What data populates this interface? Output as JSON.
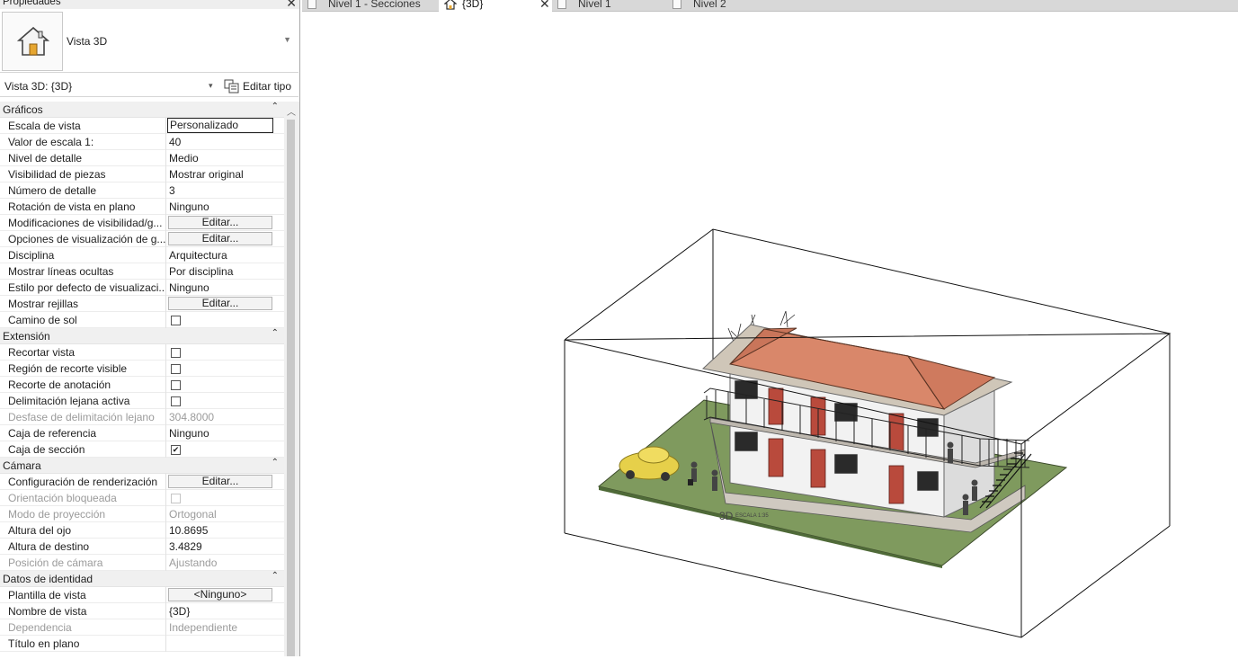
{
  "properties": {
    "title": "Propiedades",
    "type_name": "Vista 3D",
    "selector": "Vista 3D: {3D}",
    "edit_type": "Editar tipo",
    "sections": [
      {
        "name": "Gráficos",
        "rows": [
          {
            "label": "Escala de vista",
            "value": "Personalizado",
            "kind": "input"
          },
          {
            "label": "Valor de escala    1:",
            "value": "40",
            "kind": "text"
          },
          {
            "label": "Nivel de detalle",
            "value": "Medio",
            "kind": "text"
          },
          {
            "label": "Visibilidad de piezas",
            "value": "Mostrar original",
            "kind": "text"
          },
          {
            "label": "Número de detalle",
            "value": "3",
            "kind": "text"
          },
          {
            "label": "Rotación de vista en plano",
            "value": "Ninguno",
            "kind": "text"
          },
          {
            "label": "Modificaciones de visibilidad/g...",
            "value": "Editar...",
            "kind": "button"
          },
          {
            "label": "Opciones de visualización de g...",
            "value": "Editar...",
            "kind": "button"
          },
          {
            "label": "Disciplina",
            "value": "Arquitectura",
            "kind": "text"
          },
          {
            "label": "Mostrar líneas ocultas",
            "value": "Por disciplina",
            "kind": "text"
          },
          {
            "label": "Estilo por defecto de visualizaci...",
            "value": "Ninguno",
            "kind": "text"
          },
          {
            "label": "Mostrar rejillas",
            "value": "Editar...",
            "kind": "button"
          },
          {
            "label": "Camino de sol",
            "value": "",
            "kind": "check",
            "checked": false
          }
        ]
      },
      {
        "name": "Extensión",
        "rows": [
          {
            "label": "Recortar vista",
            "value": "",
            "kind": "check",
            "checked": false
          },
          {
            "label": "Región de recorte visible",
            "value": "",
            "kind": "check",
            "checked": false
          },
          {
            "label": "Recorte de anotación",
            "value": "",
            "kind": "check",
            "checked": false
          },
          {
            "label": "Delimitación lejana activa",
            "value": "",
            "kind": "check",
            "checked": false
          },
          {
            "label": "Desfase de delimitación lejano",
            "value": "304.8000",
            "kind": "text",
            "disabled": true
          },
          {
            "label": "Caja de referencia",
            "value": "Ninguno",
            "kind": "text"
          },
          {
            "label": "Caja de sección",
            "value": "",
            "kind": "check",
            "checked": true
          }
        ]
      },
      {
        "name": "Cámara",
        "rows": [
          {
            "label": "Configuración de renderización",
            "value": "Editar...",
            "kind": "button"
          },
          {
            "label": "Orientación bloqueada",
            "value": "",
            "kind": "check",
            "checked": false,
            "disabled": true
          },
          {
            "label": "Modo de proyección",
            "value": "Ortogonal",
            "kind": "text",
            "disabled": true
          },
          {
            "label": "Altura del ojo",
            "value": "10.8695",
            "kind": "text"
          },
          {
            "label": "Altura de destino",
            "value": "3.4829",
            "kind": "text"
          },
          {
            "label": "Posición de cámara",
            "value": "Ajustando",
            "kind": "text",
            "disabled": true
          }
        ]
      },
      {
        "name": "Datos de identidad",
        "rows": [
          {
            "label": "Plantilla de vista",
            "value": "<Ninguno>",
            "kind": "button"
          },
          {
            "label": "Nombre de vista",
            "value": "{3D}",
            "kind": "text"
          },
          {
            "label": "Dependencia",
            "value": "Independiente",
            "kind": "text",
            "disabled": true
          },
          {
            "label": "Título en plano",
            "value": "",
            "kind": "text"
          }
        ]
      }
    ]
  },
  "tabs": [
    {
      "label": "Nivel 1 - Secciones",
      "active": false
    },
    {
      "label": "{3D}",
      "active": true
    },
    {
      "label": "Nivel 1",
      "active": false
    },
    {
      "label": "Nivel 2",
      "active": false
    }
  ],
  "viewport": {
    "view_label": "3D",
    "scale_label": "ESCALA 1:35",
    "colors": {
      "roof": "#d9876a",
      "grass": "#7f9a5e",
      "wall": "#f2f2f2",
      "door": "#b94a3c",
      "slab": "#cfc9c0",
      "car": "#e6d04a"
    }
  }
}
